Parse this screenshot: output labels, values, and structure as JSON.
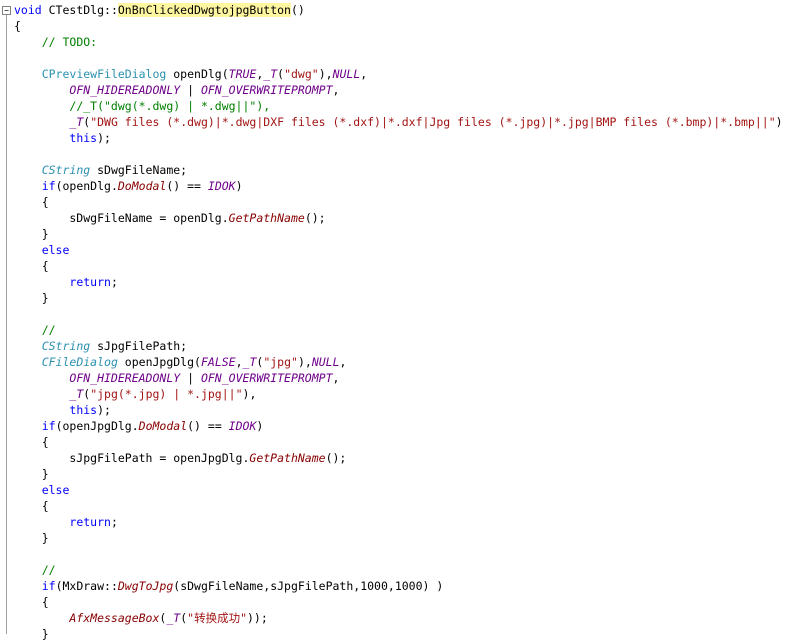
{
  "editor": {
    "fold_glyph": "−",
    "lines": [
      [
        [
          "void",
          "kw"
        ],
        [
          " CTestDlg::",
          ""
        ],
        [
          "OnBnClickedDwgtojpgButton",
          "hl"
        ],
        [
          "()",
          ""
        ]
      ],
      [
        [
          "{",
          ""
        ]
      ],
      [
        [
          "    ",
          ""
        ],
        [
          "// TODO:",
          "cmt"
        ]
      ],
      [],
      [
        [
          "    ",
          ""
        ],
        [
          "CPreviewFileDialog",
          "cls"
        ],
        [
          " openDlg(",
          ""
        ],
        [
          "TRUE",
          "mac"
        ],
        [
          ",",
          ""
        ],
        [
          "_T",
          "mac"
        ],
        [
          "(",
          ""
        ],
        [
          "\"dwg\"",
          "str"
        ],
        [
          "),",
          ""
        ],
        [
          "NULL",
          "mac"
        ],
        [
          ",",
          ""
        ]
      ],
      [
        [
          "        ",
          ""
        ],
        [
          "OFN_HIDEREADONLY",
          "mac"
        ],
        [
          " | ",
          ""
        ],
        [
          "OFN_OVERWRITEPROMPT",
          "mac"
        ],
        [
          ",",
          ""
        ]
      ],
      [
        [
          "        ",
          ""
        ],
        [
          "//_T(\"dwg(*.dwg) | *.dwg||\"),",
          "cmt"
        ]
      ],
      [
        [
          "        ",
          ""
        ],
        [
          "_T",
          "mac"
        ],
        [
          "(",
          ""
        ],
        [
          "\"DWG files (*.dwg)|*.dwg|DXF files (*.dxf)|*.dxf|Jpg files (*.jpg)|*.jpg|BMP files (*.bmp)|*.bmp||\"",
          "str"
        ],
        [
          ")",
          ""
        ]
      ],
      [
        [
          "        ",
          ""
        ],
        [
          "this",
          "kw"
        ],
        [
          ");",
          ""
        ]
      ],
      [],
      [
        [
          "    ",
          ""
        ],
        [
          "CString",
          "type"
        ],
        [
          " sDwgFileName;",
          ""
        ]
      ],
      [
        [
          "    ",
          ""
        ],
        [
          "if",
          "kw"
        ],
        [
          "(openDlg.",
          ""
        ],
        [
          "DoModal",
          "fn"
        ],
        [
          "() == ",
          ""
        ],
        [
          "IDOK",
          "mac"
        ],
        [
          ")",
          ""
        ]
      ],
      [
        [
          "    {",
          ""
        ]
      ],
      [
        [
          "        sDwgFileName = openDlg.",
          ""
        ],
        [
          "GetPathName",
          "fn"
        ],
        [
          "();",
          ""
        ]
      ],
      [
        [
          "    }",
          ""
        ]
      ],
      [
        [
          "    ",
          ""
        ],
        [
          "else",
          "kw"
        ]
      ],
      [
        [
          "    {",
          ""
        ]
      ],
      [
        [
          "        ",
          ""
        ],
        [
          "return",
          "kw"
        ],
        [
          ";",
          ""
        ]
      ],
      [
        [
          "    }",
          ""
        ]
      ],
      [],
      [
        [
          "    ",
          ""
        ],
        [
          "//",
          "cmt"
        ]
      ],
      [
        [
          "    ",
          ""
        ],
        [
          "CString",
          "type"
        ],
        [
          " sJpgFilePath;",
          ""
        ]
      ],
      [
        [
          "    ",
          ""
        ],
        [
          "CFileDialog",
          "type"
        ],
        [
          " openJpgDlg(",
          ""
        ],
        [
          "FALSE",
          "mac"
        ],
        [
          ",",
          ""
        ],
        [
          "_T",
          "mac"
        ],
        [
          "(",
          ""
        ],
        [
          "\"jpg\"",
          "str"
        ],
        [
          "),",
          ""
        ],
        [
          "NULL",
          "mac"
        ],
        [
          ",",
          ""
        ]
      ],
      [
        [
          "        ",
          ""
        ],
        [
          "OFN_HIDEREADONLY",
          "mac"
        ],
        [
          " | ",
          ""
        ],
        [
          "OFN_OVERWRITEPROMPT",
          "mac"
        ],
        [
          ",",
          ""
        ]
      ],
      [
        [
          "        ",
          ""
        ],
        [
          "_T",
          "mac"
        ],
        [
          "(",
          ""
        ],
        [
          "\"jpg(*.jpg) | *.jpg||\"",
          "str"
        ],
        [
          "),",
          ""
        ]
      ],
      [
        [
          "        ",
          ""
        ],
        [
          "this",
          "kw"
        ],
        [
          ");",
          ""
        ]
      ],
      [
        [
          "    ",
          ""
        ],
        [
          "if",
          "kw"
        ],
        [
          "(openJpgDlg.",
          ""
        ],
        [
          "DoModal",
          "fn"
        ],
        [
          "() == ",
          ""
        ],
        [
          "IDOK",
          "mac"
        ],
        [
          ")",
          ""
        ]
      ],
      [
        [
          "    {",
          ""
        ]
      ],
      [
        [
          "        sJpgFilePath = openJpgDlg.",
          ""
        ],
        [
          "GetPathName",
          "fn"
        ],
        [
          "();",
          ""
        ]
      ],
      [
        [
          "    }",
          ""
        ]
      ],
      [
        [
          "    ",
          ""
        ],
        [
          "else",
          "kw"
        ]
      ],
      [
        [
          "    {",
          ""
        ]
      ],
      [
        [
          "        ",
          ""
        ],
        [
          "return",
          "kw"
        ],
        [
          ";",
          ""
        ]
      ],
      [
        [
          "    }",
          ""
        ]
      ],
      [],
      [
        [
          "    ",
          ""
        ],
        [
          "//",
          "cmt"
        ]
      ],
      [
        [
          "    ",
          ""
        ],
        [
          "if",
          "kw"
        ],
        [
          "(MxDraw::",
          ""
        ],
        [
          "DwgToJpg",
          "fn"
        ],
        [
          "(sDwgFileName,sJpgFilePath,1000,1000) )",
          ""
        ]
      ],
      [
        [
          "    {",
          ""
        ]
      ],
      [
        [
          "        ",
          ""
        ],
        [
          "AfxMessageBox",
          "fn"
        ],
        [
          "(",
          ""
        ],
        [
          "_T",
          "mac"
        ],
        [
          "(",
          ""
        ],
        [
          "\"转换成功\"",
          "str"
        ],
        [
          "));",
          ""
        ]
      ],
      [
        [
          "    }",
          ""
        ]
      ]
    ]
  }
}
